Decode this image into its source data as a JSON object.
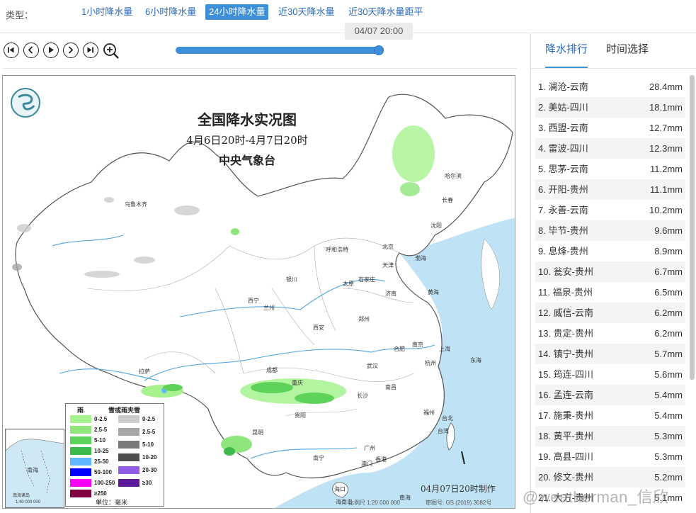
{
  "type_label": "类型：",
  "tabs": [
    {
      "label": "1小时降水量",
      "active": false
    },
    {
      "label": "6小时降水量",
      "active": false
    },
    {
      "label": "24小时降水量",
      "active": true
    },
    {
      "label": "近30天降水量",
      "active": false
    },
    {
      "label": "近30天降水量距平",
      "active": false
    }
  ],
  "player": {
    "time_tip": "04/07 20:00",
    "progress": 1.0
  },
  "map": {
    "title": "全国降水实况图",
    "subtitle": "4月6日20时-4月7日20时",
    "org": "中央气象台",
    "made_by": "04月07日20时制作",
    "scale": "比例尺 1:20 000 000",
    "review": "审图号: GS (2019) 3082号",
    "cities": {
      "wulumuqi": "乌鲁木齐",
      "haerbin": "哈尔滨",
      "changchun": "长春",
      "shenyang": "沈阳",
      "huhehaote": "呼和浩特",
      "beijing": "北京",
      "tianjin": "天津",
      "yinchuan": "银川",
      "shijiazhuang": "石家庄",
      "taiyuan": "太原",
      "jinan": "济南",
      "xining": "西宁",
      "lanzhou": "兰州",
      "zhengzhou": "郑州",
      "xian": "西安",
      "hefei": "合肥",
      "nanjing": "南京",
      "shanghai": "上海",
      "lasa": "拉萨",
      "chengdu": "成都",
      "wuhan": "武汉",
      "hangzhou": "杭州",
      "chongqing": "重庆",
      "nanchang": "南昌",
      "changsha": "长沙",
      "fuzhou": "福州",
      "guiyang": "贵阳",
      "taibei": "台北",
      "kunming": "昆明",
      "guangzhou": "广州",
      "nanning": "南宁",
      "xianggang": "香港",
      "aomen": "澳门",
      "haikou": "海口",
      "donghai": "东海",
      "huanghai": "黄海",
      "bohai": "渤海",
      "nanhai": "南海",
      "taiwan": "台湾",
      "hainandao": "海南岛"
    },
    "inset": {
      "label": "南海诸岛",
      "scale": "1:40 000 000",
      "sea": "南海"
    }
  },
  "legend": {
    "rain_title": "雨",
    "snow_title": "雪或雨夹雪",
    "rain": [
      {
        "label": "0-2.5",
        "color": "#a6f28f"
      },
      {
        "label": "2.5-5",
        "color": "#8ee57c"
      },
      {
        "label": "5-10",
        "color": "#5fd25a"
      },
      {
        "label": "10-25",
        "color": "#3cb94a"
      },
      {
        "label": "25-50",
        "color": "#61b8ff"
      },
      {
        "label": "50-100",
        "color": "#0000fe"
      },
      {
        "label": "100-250",
        "color": "#fa00fa"
      },
      {
        "label": "≥250",
        "color": "#800040"
      }
    ],
    "snow": [
      {
        "label": "0-2.5",
        "color": "#cccccc"
      },
      {
        "label": "2.5-5",
        "color": "#a6a6a6"
      },
      {
        "label": "5-10",
        "color": "#7a7a7a"
      },
      {
        "label": "10-20",
        "color": "#4d4d4d"
      },
      {
        "label": "20-30",
        "color": "#8f5ce6"
      },
      {
        "label": "≥30",
        "color": "#5a1a9a"
      }
    ],
    "unit": "单位：毫米"
  },
  "panel": {
    "tabs": [
      {
        "label": "降水排行",
        "active": true
      },
      {
        "label": "时间选择",
        "active": false
      }
    ],
    "ranking": [
      {
        "name": "1. 澜沧-云南",
        "value": "28.4mm"
      },
      {
        "name": "2. 美姑-四川",
        "value": "18.1mm"
      },
      {
        "name": "3. 西盟-云南",
        "value": "12.7mm"
      },
      {
        "name": "4. 雷波-四川",
        "value": "12.3mm"
      },
      {
        "name": "5. 思茅-云南",
        "value": "11.2mm"
      },
      {
        "name": "6. 开阳-贵州",
        "value": "11.1mm"
      },
      {
        "name": "7. 永善-云南",
        "value": "10.2mm"
      },
      {
        "name": "8. 毕节-贵州",
        "value": "9.6mm"
      },
      {
        "name": "9. 息烽-贵州",
        "value": "8.9mm"
      },
      {
        "name": "10. 瓮安-贵州",
        "value": "6.7mm"
      },
      {
        "name": "11. 福泉-贵州",
        "value": "6.5mm"
      },
      {
        "name": "12. 威信-云南",
        "value": "6.2mm"
      },
      {
        "name": "13. 贵定-贵州",
        "value": "6.2mm"
      },
      {
        "name": "14. 镇宁-贵州",
        "value": "5.7mm"
      },
      {
        "name": "15. 筠连-四川",
        "value": "5.6mm"
      },
      {
        "name": "16. 孟连-云南",
        "value": "5.4mm"
      },
      {
        "name": "17. 施秉-贵州",
        "value": "5.4mm"
      },
      {
        "name": "18. 黄平-贵州",
        "value": "5.3mm"
      },
      {
        "name": "19. 高县-四川",
        "value": "5.3mm"
      },
      {
        "name": "20. 修文-贵州",
        "value": "5.2mm"
      },
      {
        "name": "21. 大方-贵州",
        "value": "5.1mm"
      }
    ]
  },
  "watermark": "@weatherman_信欣"
}
